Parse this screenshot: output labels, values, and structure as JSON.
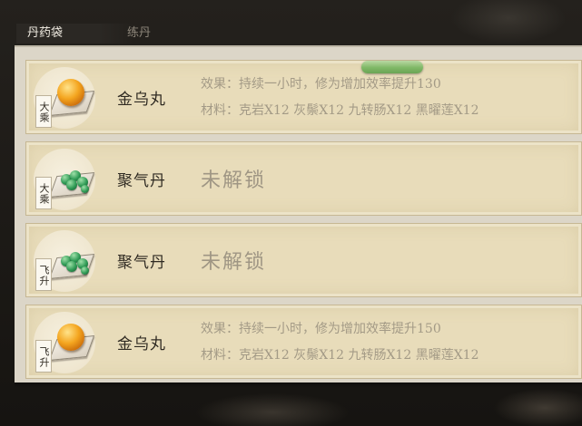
{
  "tabs": [
    {
      "label": "丹药袋",
      "active": true
    },
    {
      "label": "练丹",
      "active": false
    }
  ],
  "rows": [
    {
      "realm": "大乘",
      "name": "金乌丸",
      "icon": "golden-pill-icon",
      "locked": false,
      "effect": "效果：持续一小时，修为增加效率提升130",
      "materials": "材料：克岩X12 灰鬃X12 九转肠X12 黑曜莲X12"
    },
    {
      "realm": "大乘",
      "name": "聚气丹",
      "icon": "green-beads-icon",
      "locked": true,
      "locked_text": "未解锁"
    },
    {
      "realm": "飞升",
      "name": "聚气丹",
      "icon": "green-beads-icon",
      "locked": true,
      "locked_text": "未解锁"
    },
    {
      "realm": "飞升",
      "name": "金乌丸",
      "icon": "golden-pill-icon",
      "locked": false,
      "effect": "效果：持续一小时，修为增加效率提升150",
      "materials": "材料：克岩X12 灰鬃X12 九转肠X12 黑曜莲X12"
    }
  ],
  "colors": {
    "panel": "#dcd6c8",
    "row": "#e8dcba",
    "scroll_indicator": "#7fb866"
  }
}
